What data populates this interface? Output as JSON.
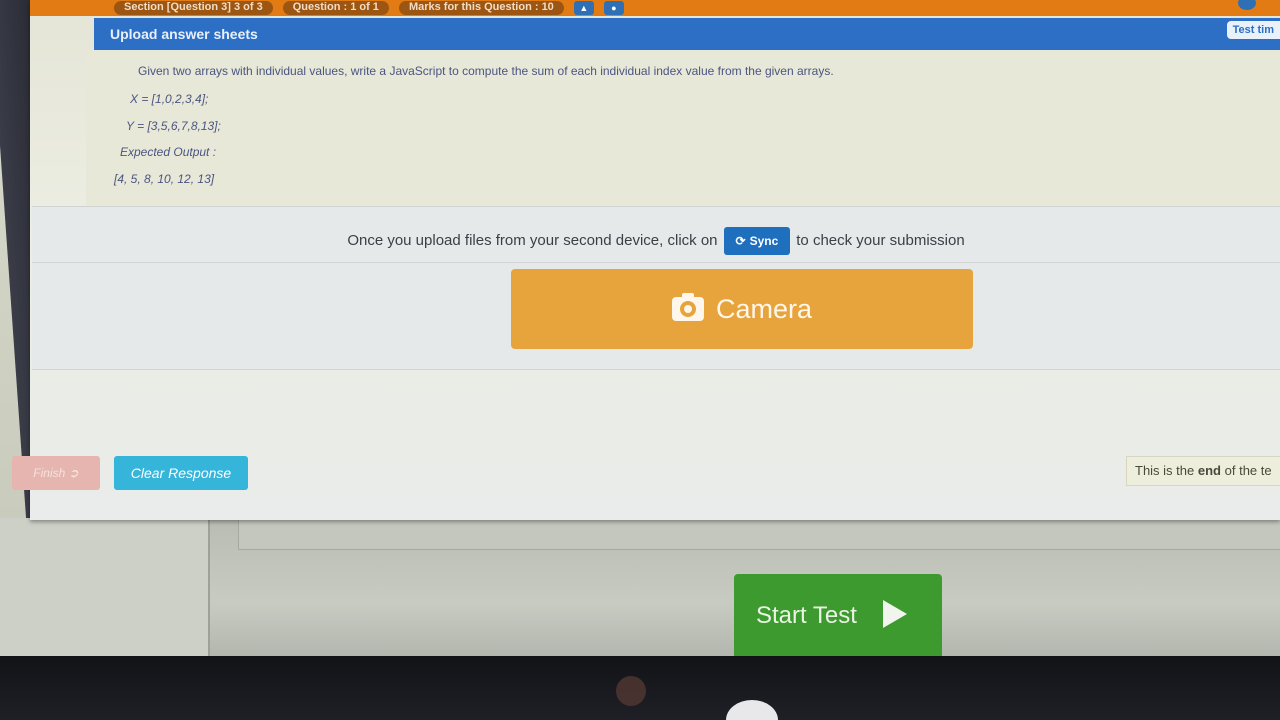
{
  "top_bar": {
    "section": "Section [Question 3] 3 of 3",
    "question": "Question : 1 of 1",
    "marks": "Marks for this Question : 10"
  },
  "header": {
    "title": "Upload answer sheets",
    "test_time": "Test tim"
  },
  "question": {
    "prompt": "Given two arrays with individual values, write a JavaScript to compute the sum of each individual index value from the given arrays.",
    "line_x": "X = [1,0,2,3,4];",
    "line_y": "Y = [3,5,6,7,8,13];",
    "expected_label": "Expected Output :",
    "expected_value": "[4, 5, 8, 10, 12, 13]"
  },
  "upload": {
    "sync_prefix": "Once you upload files from your second device, click on",
    "sync_label": "Sync",
    "sync_suffix": "to check your submission",
    "camera_label": "Camera"
  },
  "footer": {
    "finish_label": "Finish",
    "clear_label": "Clear Response",
    "end_prefix": "This is the",
    "end_bold": "end",
    "end_suffix": "of the te"
  },
  "background": {
    "start_test_label": "Start Test"
  },
  "colors": {
    "orange_bar": "#e27b14",
    "header_blue": "#2d6fc4",
    "camera_orange": "#e8a43c",
    "clear_cyan": "#36b5db",
    "start_green": "#3d9a2f"
  },
  "icons": {
    "sync": "refresh-icon",
    "camera": "camera-icon",
    "finish": "exit-icon",
    "start": "play-icon"
  }
}
